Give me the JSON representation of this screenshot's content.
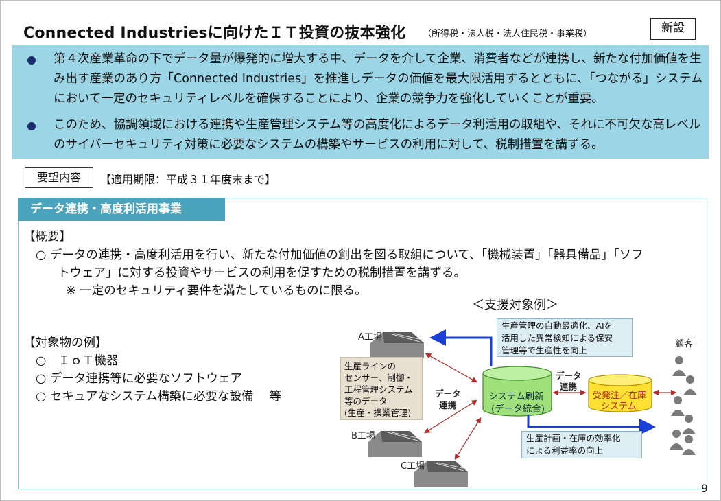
{
  "header": {
    "title": "Connected Industriesに向けたＩＴ投資の抜本強化",
    "subtitle": "（所得税・法人税・法人住民税・事業税）",
    "badge": "新設"
  },
  "summary": {
    "bullets": [
      "第４次産業革命の下でデータ量が爆発的に増大する中、データを介して企業、消費者などが連携し、新たな付加価値を生み出す産業のあり方「Connected Industries」を推進しデータの価値を最大限活用するとともに、「つながる」システムにおいて一定のセキュリティレベルを確保することにより、企業の競争力を強化していくことが重要。",
      "このため、協調領域における連携や生産管理システム等の高度化によるデータ利活用の取組や、それに不可欠な高レベルのサイバーセキュリティ対策に必要なシステムの構築やサービスの利用に対して、税制措置を講ずる。"
    ]
  },
  "request": {
    "label": "要望内容",
    "period": "【適用期限：平成３１年度末まで】"
  },
  "section": {
    "title": "データ連携・高度利活用事業",
    "overview_heading": "【概要】",
    "overview_line1": "○ データの連携・高度利活用を行い、新たな付加価値の創出を図る取組について、「機械装置」「器具備品」「ソフ",
    "overview_line2": "トウェア」に対する投資やサービスの利用を促すための税制措置を講ずる。",
    "overview_note": "※ 一定のセキュリティ要件を満たしているものに限る。",
    "targets_heading": "【対象物の例】",
    "targets": [
      "○　ＩｏＴ機器",
      "○ データ連携等に必要なソフトウェア",
      "○ セキュアなシステム構築に必要な設備　 等"
    ]
  },
  "diagram": {
    "title": "＜支援対象例＞",
    "factories": [
      "A工場",
      "B工場",
      "C工場"
    ],
    "factory_data": [
      "生産ラインの",
      "センサー、制御・",
      "工程管理システム",
      "等のデータ",
      "(生産・操業管理)"
    ],
    "link_label_1": [
      "データ",
      "連携"
    ],
    "link_label_2": [
      "データ",
      "連携"
    ],
    "system_renew": [
      "システム刷新",
      "(データ統合)"
    ],
    "order_system": [
      "受発注／在庫",
      "システム"
    ],
    "customers_label": "顧客",
    "callout_top": [
      "生産管理の自動最適化、AIを",
      "活用した異常検知による保安",
      "管理等で生産性を向上"
    ],
    "callout_bottom": [
      "生産計画・在庫の効率化",
      "による利益率の向上"
    ]
  },
  "page_number": "9",
  "colors": {
    "summary_bg": "#9cd6e6",
    "section_head": "#4aa4bd",
    "cylinder_green": "#9fe07a",
    "cylinder_yellow": "#ffe033",
    "arrow_blue": "#1a3fd6",
    "arrow_red": "#b42a2a"
  }
}
